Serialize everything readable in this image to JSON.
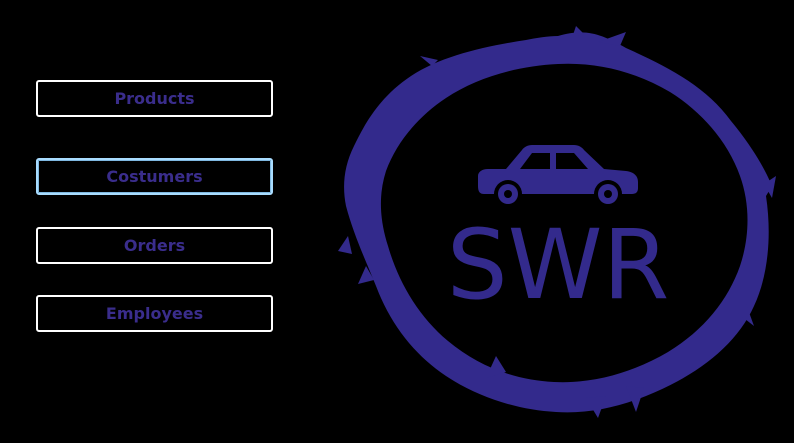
{
  "colors": {
    "background": "#000000",
    "brand": "#332a8c",
    "button_border": "#ffffff",
    "button_focus_border": "#a9dcff"
  },
  "nav": {
    "products_label": "Products",
    "costumers_label": "Costumers",
    "orders_label": "Orders",
    "employees_label": "Employees",
    "focused_item": "Costumers"
  },
  "logo": {
    "text": "SWR",
    "icon": "car-icon"
  }
}
